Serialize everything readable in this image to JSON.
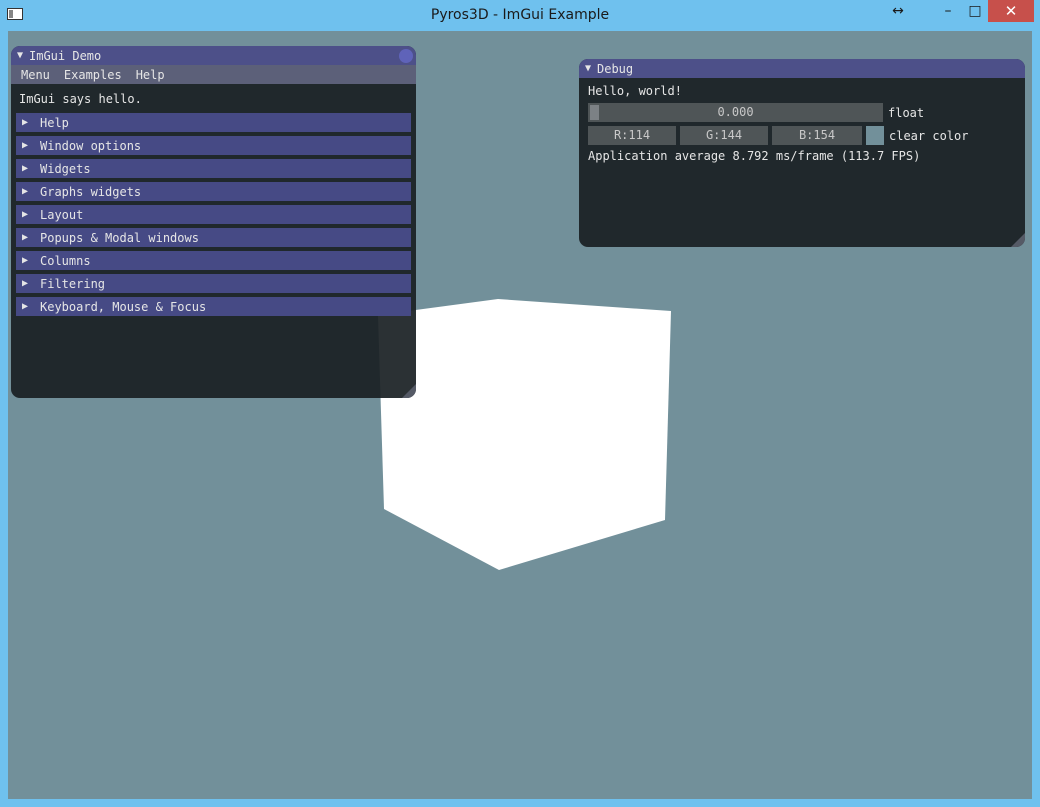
{
  "window": {
    "title": "Pyros3D - ImGui Example",
    "controls": {
      "resize": "↔",
      "minimize": "–",
      "maximize": "□",
      "close": "✕"
    }
  },
  "scene": {
    "background_color": "#72909a",
    "cube_color": "#ffffff"
  },
  "demo_window": {
    "title": "ImGui Demo",
    "menus": [
      "Menu",
      "Examples",
      "Help"
    ],
    "greeting": "ImGui says hello.",
    "headers": [
      "Help",
      "Window options",
      "Widgets",
      "Graphs widgets",
      "Layout",
      "Popups & Modal windows",
      "Columns",
      "Filtering",
      "Keyboard, Mouse & Focus"
    ]
  },
  "debug_window": {
    "title": "Debug",
    "hello": "Hello, world!",
    "slider_value": "0.000",
    "slider_label": "float",
    "color": {
      "r": "R:114",
      "g": "G:144",
      "b": "B:154",
      "label": "clear color",
      "swatch": "#72909a"
    },
    "stats": "Application average 8.792 ms/frame (113.7 FPS)"
  },
  "colors": {
    "titlebar": "#6fc1ee",
    "close_button": "#c7504b",
    "window_title_bg": "#4d5089",
    "header_bg": "#464a85"
  }
}
